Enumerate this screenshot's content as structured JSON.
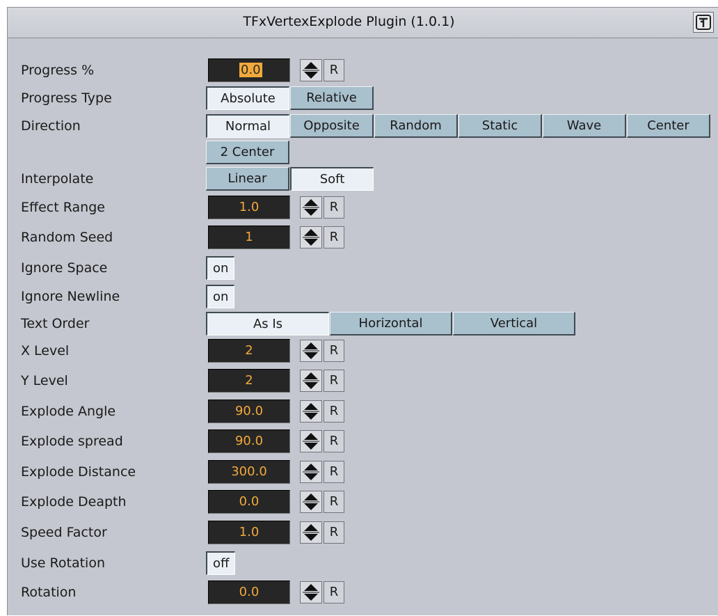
{
  "window": {
    "title": "TFxVertexExplode Plugin (1.0.1)",
    "icon": "plugin-logo-icon"
  },
  "reset_label": "R",
  "progress": {
    "label": "Progress %",
    "value": "0.0"
  },
  "progress_type": {
    "label": "Progress Type",
    "options": [
      "Absolute",
      "Relative"
    ],
    "selected": "Absolute"
  },
  "direction": {
    "label": "Direction",
    "options": [
      "Normal",
      "Opposite",
      "Random",
      "Static",
      "Wave",
      "Center",
      "2 Center"
    ],
    "selected": "Normal"
  },
  "interpolate": {
    "label": "Interpolate",
    "options": [
      "Linear",
      "Soft"
    ],
    "selected": "Soft"
  },
  "effect_range": {
    "label": "Effect Range",
    "value": "1.0"
  },
  "random_seed": {
    "label": "Random Seed",
    "value": "1"
  },
  "ignore_space": {
    "label": "Ignore Space",
    "value": "on"
  },
  "ignore_newline": {
    "label": "Ignore Newline",
    "value": "on"
  },
  "text_order": {
    "label": "Text Order",
    "options": [
      "As Is",
      "Horizontal",
      "Vertical"
    ],
    "selected": "As Is"
  },
  "x_level": {
    "label": "X Level",
    "value": "2"
  },
  "y_level": {
    "label": "Y Level",
    "value": "2"
  },
  "explode_angle": {
    "label": "Explode Angle",
    "value": "90.0"
  },
  "explode_spread": {
    "label": "Explode spread",
    "value": "90.0"
  },
  "explode_distance": {
    "label": "Explode Distance",
    "value": "300.0"
  },
  "explode_depth": {
    "label": "Explode Deapth",
    "value": "0.0"
  },
  "speed_factor": {
    "label": "Speed Factor",
    "value": "1.0"
  },
  "use_rotation": {
    "label": "Use Rotation",
    "value": "off"
  },
  "rotation": {
    "label": "Rotation",
    "value": "0.0"
  }
}
